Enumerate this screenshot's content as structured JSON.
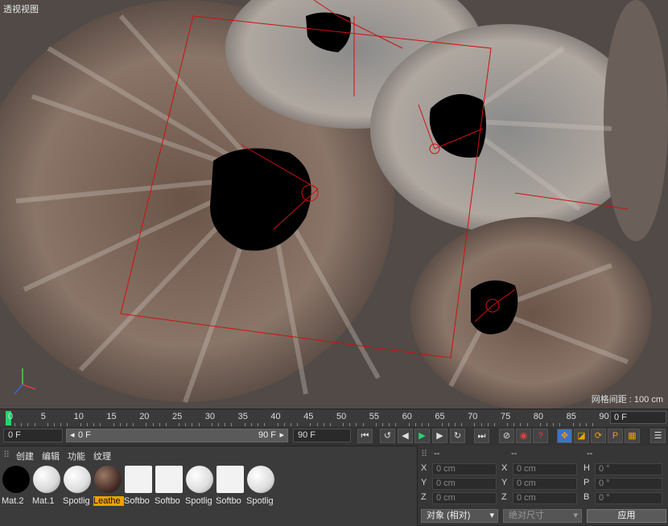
{
  "viewport": {
    "title": "透视视图",
    "grid_note": "网格间距 : 100 cm"
  },
  "timeline": {
    "ticks": [
      "0",
      "5",
      "10",
      "15",
      "20",
      "25",
      "30",
      "35",
      "40",
      "45",
      "50",
      "55",
      "60",
      "65",
      "70",
      "75",
      "80",
      "85",
      "90"
    ],
    "current_frame": "0 F"
  },
  "transport": {
    "start": "0 F",
    "range_start": "0 F",
    "range_end": "90 F",
    "end": "90 F"
  },
  "materials": {
    "menu": [
      "创建",
      "编辑",
      "功能",
      "纹理"
    ],
    "items": [
      {
        "label": "Mat.2"
      },
      {
        "label": "Mat.1"
      },
      {
        "label": "Spotlig"
      },
      {
        "label": "Leathe",
        "selected": true
      },
      {
        "label": "Softbo"
      },
      {
        "label": "Softbo"
      },
      {
        "label": "Spotlig"
      },
      {
        "label": "Softbo"
      },
      {
        "label": "Spotlig"
      }
    ]
  },
  "coords": {
    "headers": [
      "--",
      "--",
      "--"
    ],
    "rows": [
      {
        "a": "X",
        "av": "0 cm",
        "b": "X",
        "bv": "0 cm",
        "c": "H",
        "cv": "0 °"
      },
      {
        "a": "Y",
        "av": "0 cm",
        "b": "Y",
        "bv": "0 cm",
        "c": "P",
        "cv": "0 °"
      },
      {
        "a": "Z",
        "av": "0 cm",
        "b": "Z",
        "bv": "0 cm",
        "c": "B",
        "cv": "0 °"
      }
    ],
    "mode": "对象 (相对)",
    "size_mode": "绝对尺寸",
    "apply": "应用"
  }
}
